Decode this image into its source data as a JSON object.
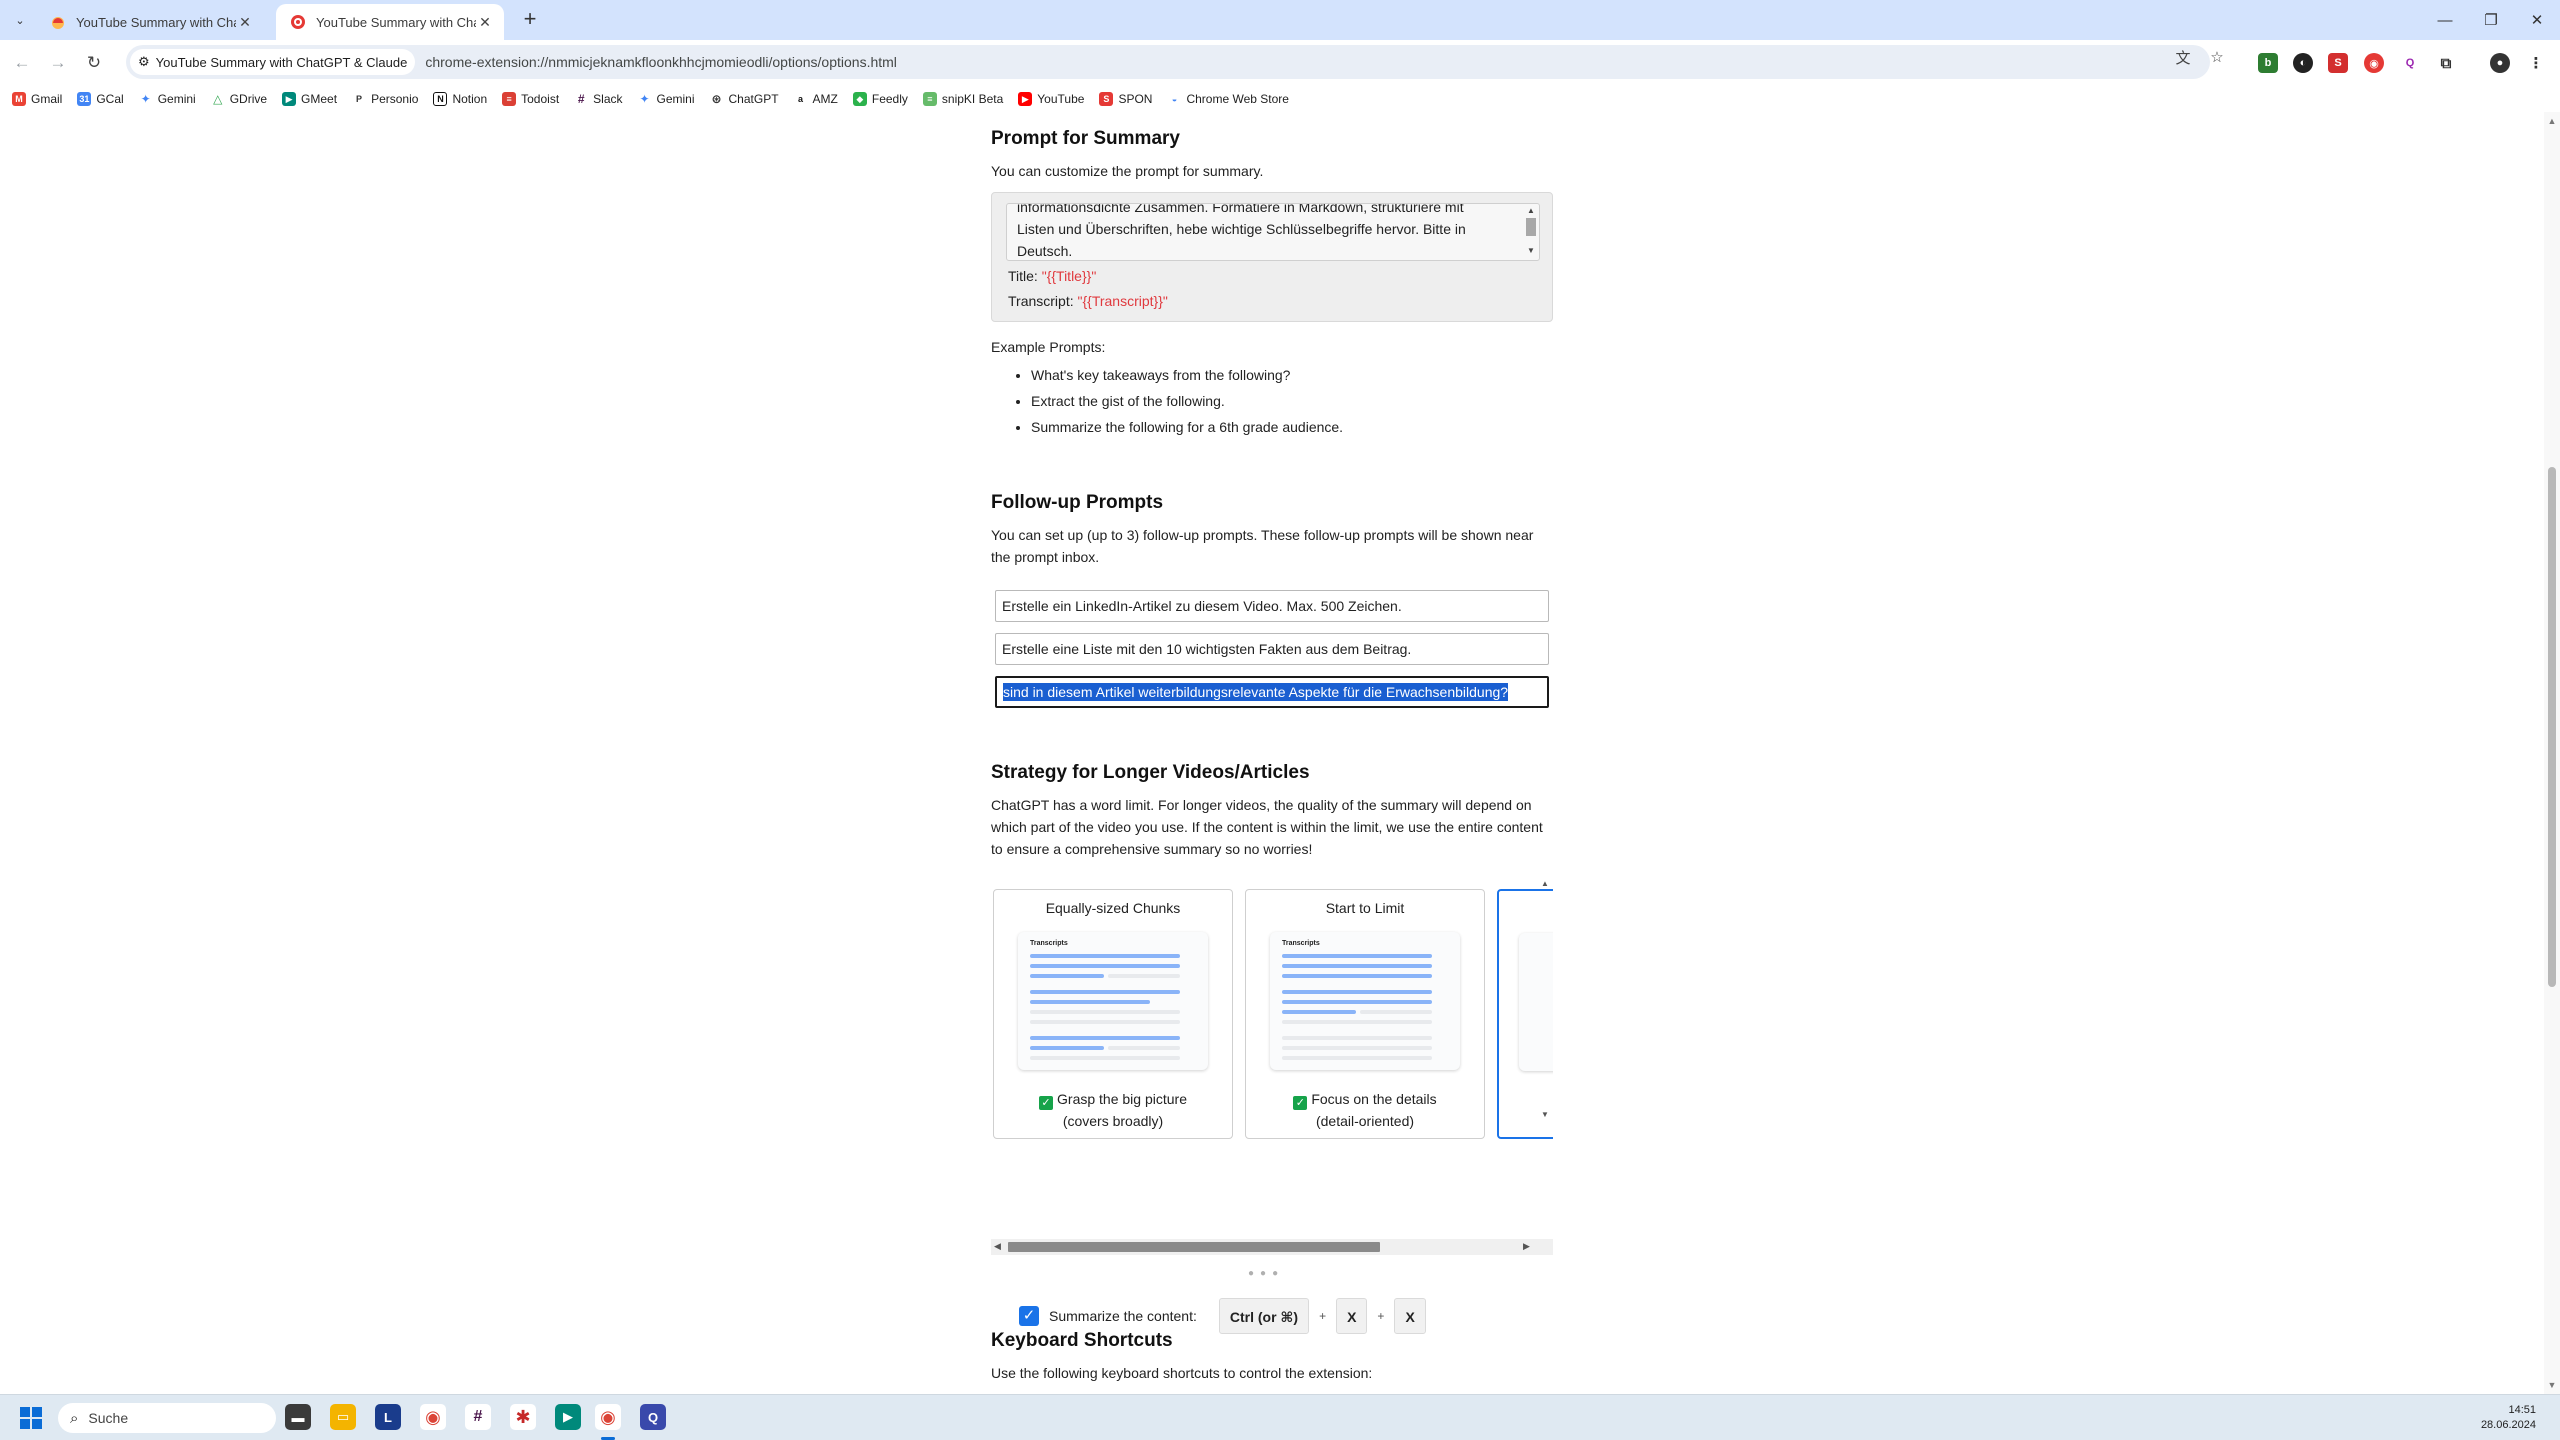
{
  "browser": {
    "tabs": [
      {
        "title": "YouTube Summary with ChatGPT & Claude",
        "active": false
      },
      {
        "title": "YouTube Summary with ChatGPT & Claude",
        "active": true
      }
    ],
    "chip_label": "YouTube Summary with ChatGPT & Claude",
    "url": "chrome-extension://nmmicjeknamkfloonkhhcjmomieodli/options/options.html",
    "bookmarks": [
      "Gmail",
      "GCal",
      "Gemini",
      "GDrive",
      "GMeet",
      "Personio",
      "Notion",
      "Todoist",
      "Slack",
      "Gemini",
      "ChatGPT",
      "AMZ",
      "Feedly",
      "snipKI Beta",
      "YouTube",
      "SPON",
      "Chrome Web Store"
    ]
  },
  "prompt_section": {
    "title": "Prompt for Summary",
    "description": "You can customize the prompt for summary.",
    "textarea_lines": [
      "informationsdichte Zusammen. Formatiere in Markdown, strukturiere mit",
      "Listen und Überschriften, hebe wichtige Schlüsselbegriffe hervor. Bitte in",
      "Deutsch."
    ],
    "title_label": "Title: ",
    "title_var": "\"{{Title}}\"",
    "transcript_label": "Transcript: ",
    "transcript_var": "\"{{Transcript}}\"",
    "examples_label": "Example Prompts:",
    "examples": [
      "What's key takeaways from the following?",
      "Extract the gist of the following.",
      "Summarize the following for a 6th grade audience."
    ]
  },
  "followup_section": {
    "title": "Follow-up Prompts",
    "description": "You can set up (up to 3) follow-up prompts. These follow-up prompts will be shown near the prompt inbox.",
    "prompts": [
      "Erstelle ein LinkedIn-Artikel zu diesem Video. Max. 500 Zeichen.",
      "Erstelle eine Liste mit den 10 wichtigsten Fakten aus dem Beitrag.",
      "sind in diesem Artikel weiterbildungsrelevante Aspekte für die Erwachsenbildung?"
    ]
  },
  "strategy_section": {
    "title": "Strategy for Longer Videos/Articles",
    "description": "ChatGPT has a word limit. For longer videos, the quality of the summary will depend on which part of the video you use. If the content is within the limit, we use the entire content to ensure a comprehensive summary so no worries!",
    "cards": [
      {
        "title": "Equally-sized Chunks",
        "illustration_label": "Transcripts",
        "line1": "Grasp the big picture",
        "line2": "(covers broadly)",
        "checked": true
      },
      {
        "title": "Start to Limit",
        "illustration_label": "Transcripts",
        "line1": "Focus on the details",
        "line2": "(detail-oriented)",
        "checked": true
      }
    ]
  },
  "keyboard_section": {
    "title": "Keyboard Shortcuts",
    "description": "Use the following keyboard shortcuts to control the extension:",
    "shortcut_label": "Summarize the content:",
    "keys": [
      "Ctrl (or ⌘)",
      "X",
      "X"
    ],
    "plus": "+"
  },
  "taskbar": {
    "search_placeholder": "Suche",
    "time": "14:51",
    "date": "28.06.2024"
  },
  "colors": {
    "tabstrip": "#d3e3fd",
    "accent": "#1a73e8",
    "checkbox_green": "#16a34a",
    "template_var": "#e0393e",
    "selection": "#1a5fd1"
  }
}
